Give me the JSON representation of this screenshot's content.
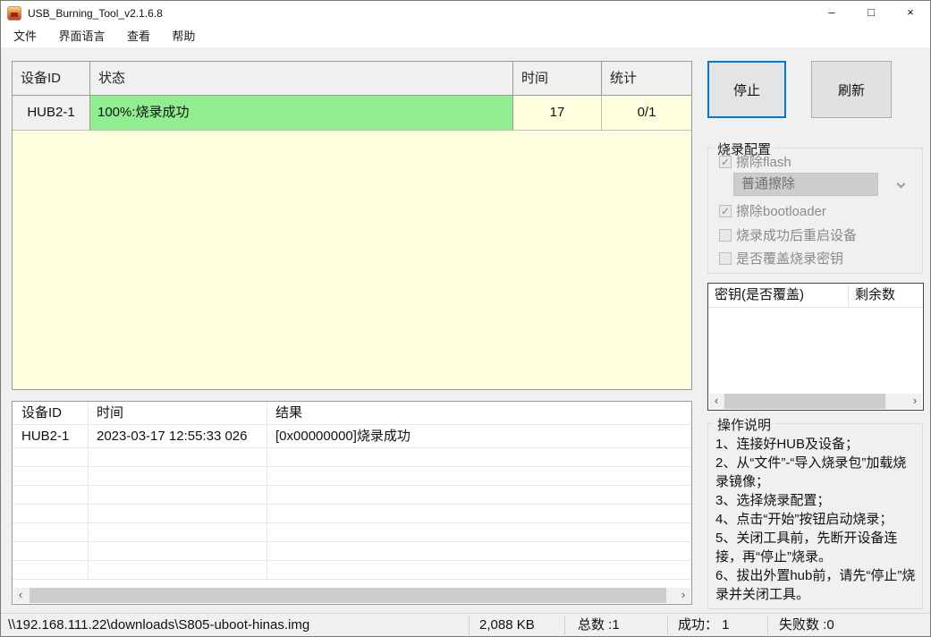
{
  "window": {
    "title": "USB_Burning_Tool_v2.1.6.8",
    "controls": {
      "minimize": "–",
      "maximize": "□",
      "close": "×"
    }
  },
  "icons": {
    "check": "✓",
    "scroll_left": "‹",
    "scroll_right": "›"
  },
  "menu": {
    "items": [
      "文件",
      "界面语言",
      "查看",
      "帮助"
    ]
  },
  "device_table": {
    "headers": [
      "设备ID",
      "状态",
      "时间",
      "统计"
    ],
    "row": {
      "device_id": "HUB2-1",
      "status": "100%:烧录成功",
      "time": "17",
      "stats": "0/1"
    },
    "colors": {
      "status_bg": "#90EE90",
      "body_bg": "#FFFFE0"
    }
  },
  "actions": {
    "stop": "停止",
    "refresh": "刷新"
  },
  "burn_config": {
    "title": "烧录配置",
    "options": [
      {
        "label": "擦除flash",
        "checked": true
      },
      {
        "label": "擦除bootloader",
        "checked": true
      },
      {
        "label": "烧录成功后重启设备",
        "checked": false
      },
      {
        "label": "是否覆盖烧录密钥",
        "checked": false
      }
    ],
    "erase_mode": "普通擦除"
  },
  "key_table": {
    "headers": [
      "密钥(是否覆盖)",
      "剩余数"
    ]
  },
  "instructions": {
    "title": "操作说明",
    "lines": [
      "1、连接好HUB及设备；",
      "2、从“文件”-“导入烧录包”加载烧录镜像；",
      "3、选择烧录配置；",
      "4、点击“开始”按钮启动烧录；",
      "5、关闭工具前，先断开设备连接，再“停止”烧录。",
      "6、拔出外置hub前，请先“停止”烧录并关闭工具。"
    ]
  },
  "log_table": {
    "headers": [
      "设备ID",
      "时间",
      "结果"
    ],
    "rows": [
      {
        "device_id": "HUB2-1",
        "time": "2023-03-17 12:55:33 026",
        "result": "[0x00000000]烧录成功"
      }
    ]
  },
  "status_bar": {
    "file_path": "\\\\192.168.111.22\\downloads\\S805-uboot-hinas.img",
    "file_size": "2,088 KB",
    "total": "总数 :1",
    "success": "成功： 1",
    "failed": "失败数 :0"
  }
}
